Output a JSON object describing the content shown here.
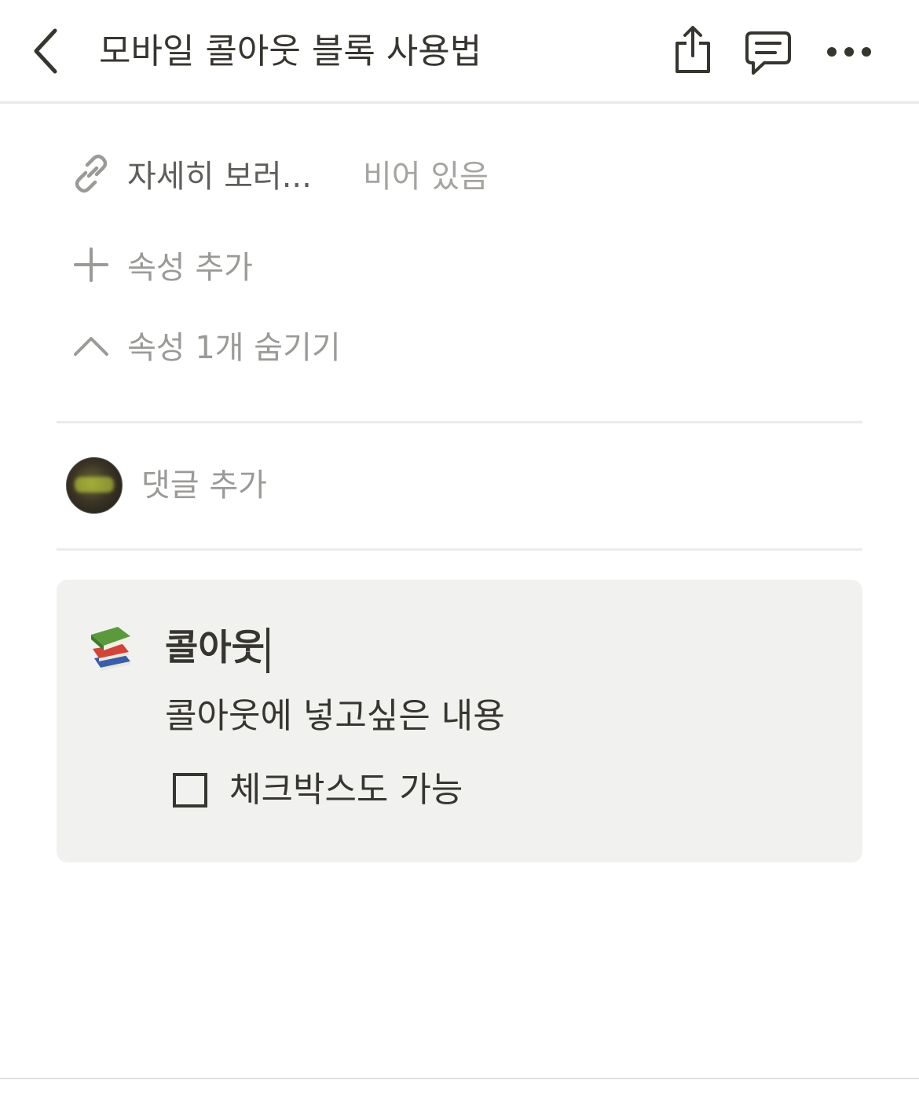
{
  "header": {
    "title": "모바일 콜아웃 블록 사용법",
    "icons": [
      "back-icon",
      "share-icon",
      "comment-icon",
      "more-icon"
    ]
  },
  "properties": {
    "link_property": {
      "name": "자세히 보러...",
      "value": "비어 있음",
      "icon": "link-icon"
    },
    "add_property": {
      "label": "속성 추가",
      "icon": "plus-icon"
    },
    "hide_properties": {
      "label": "속성 1개 숨기기",
      "icon": "chevron-up-icon"
    }
  },
  "comment": {
    "placeholder": "댓글 추가"
  },
  "callout": {
    "emoji": "books-icon",
    "title": "콜아웃",
    "body": "콜아웃에 넣고싶은 내용",
    "todo": {
      "label": "체크박스도 가능",
      "checked": false
    },
    "background": "#f1f1ef"
  }
}
